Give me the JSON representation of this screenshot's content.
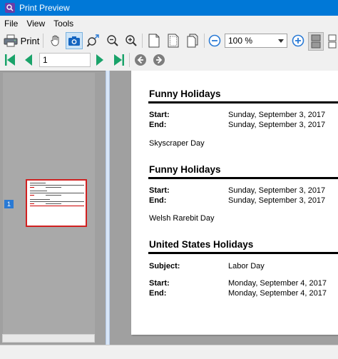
{
  "window": {
    "title": "Print Preview"
  },
  "menu": {
    "file": "File",
    "view": "View",
    "tools": "Tools"
  },
  "toolbar": {
    "print_label": "Print",
    "zoom_value": "100 %"
  },
  "navigation": {
    "page_value": "1"
  },
  "thumbnails": {
    "page_number": "1"
  },
  "document": {
    "sections": [
      {
        "title": "Funny Holidays",
        "start_label": "Start:",
        "start_value": "Sunday, September 3, 2017",
        "end_label": "End:",
        "end_value": "Sunday, September 3, 2017",
        "description": "Skyscraper Day"
      },
      {
        "title": "Funny Holidays",
        "start_label": "Start:",
        "start_value": "Sunday, September 3, 2017",
        "end_label": "End:",
        "end_value": "Sunday, September 3, 2017",
        "description": "Welsh Rarebit Day"
      },
      {
        "title": "United States Holidays",
        "subject_label": "Subject:",
        "subject_value": "Labor Day",
        "start_label": "Start:",
        "start_value": "Monday, September 4, 2017",
        "end_label": "End:",
        "end_value": "Monday, September 4, 2017"
      }
    ]
  },
  "colors": {
    "titlebar": "#0078d7",
    "accent": "#2a7ad5",
    "nav_green": "#1aa36a",
    "selection": "#d02020"
  }
}
